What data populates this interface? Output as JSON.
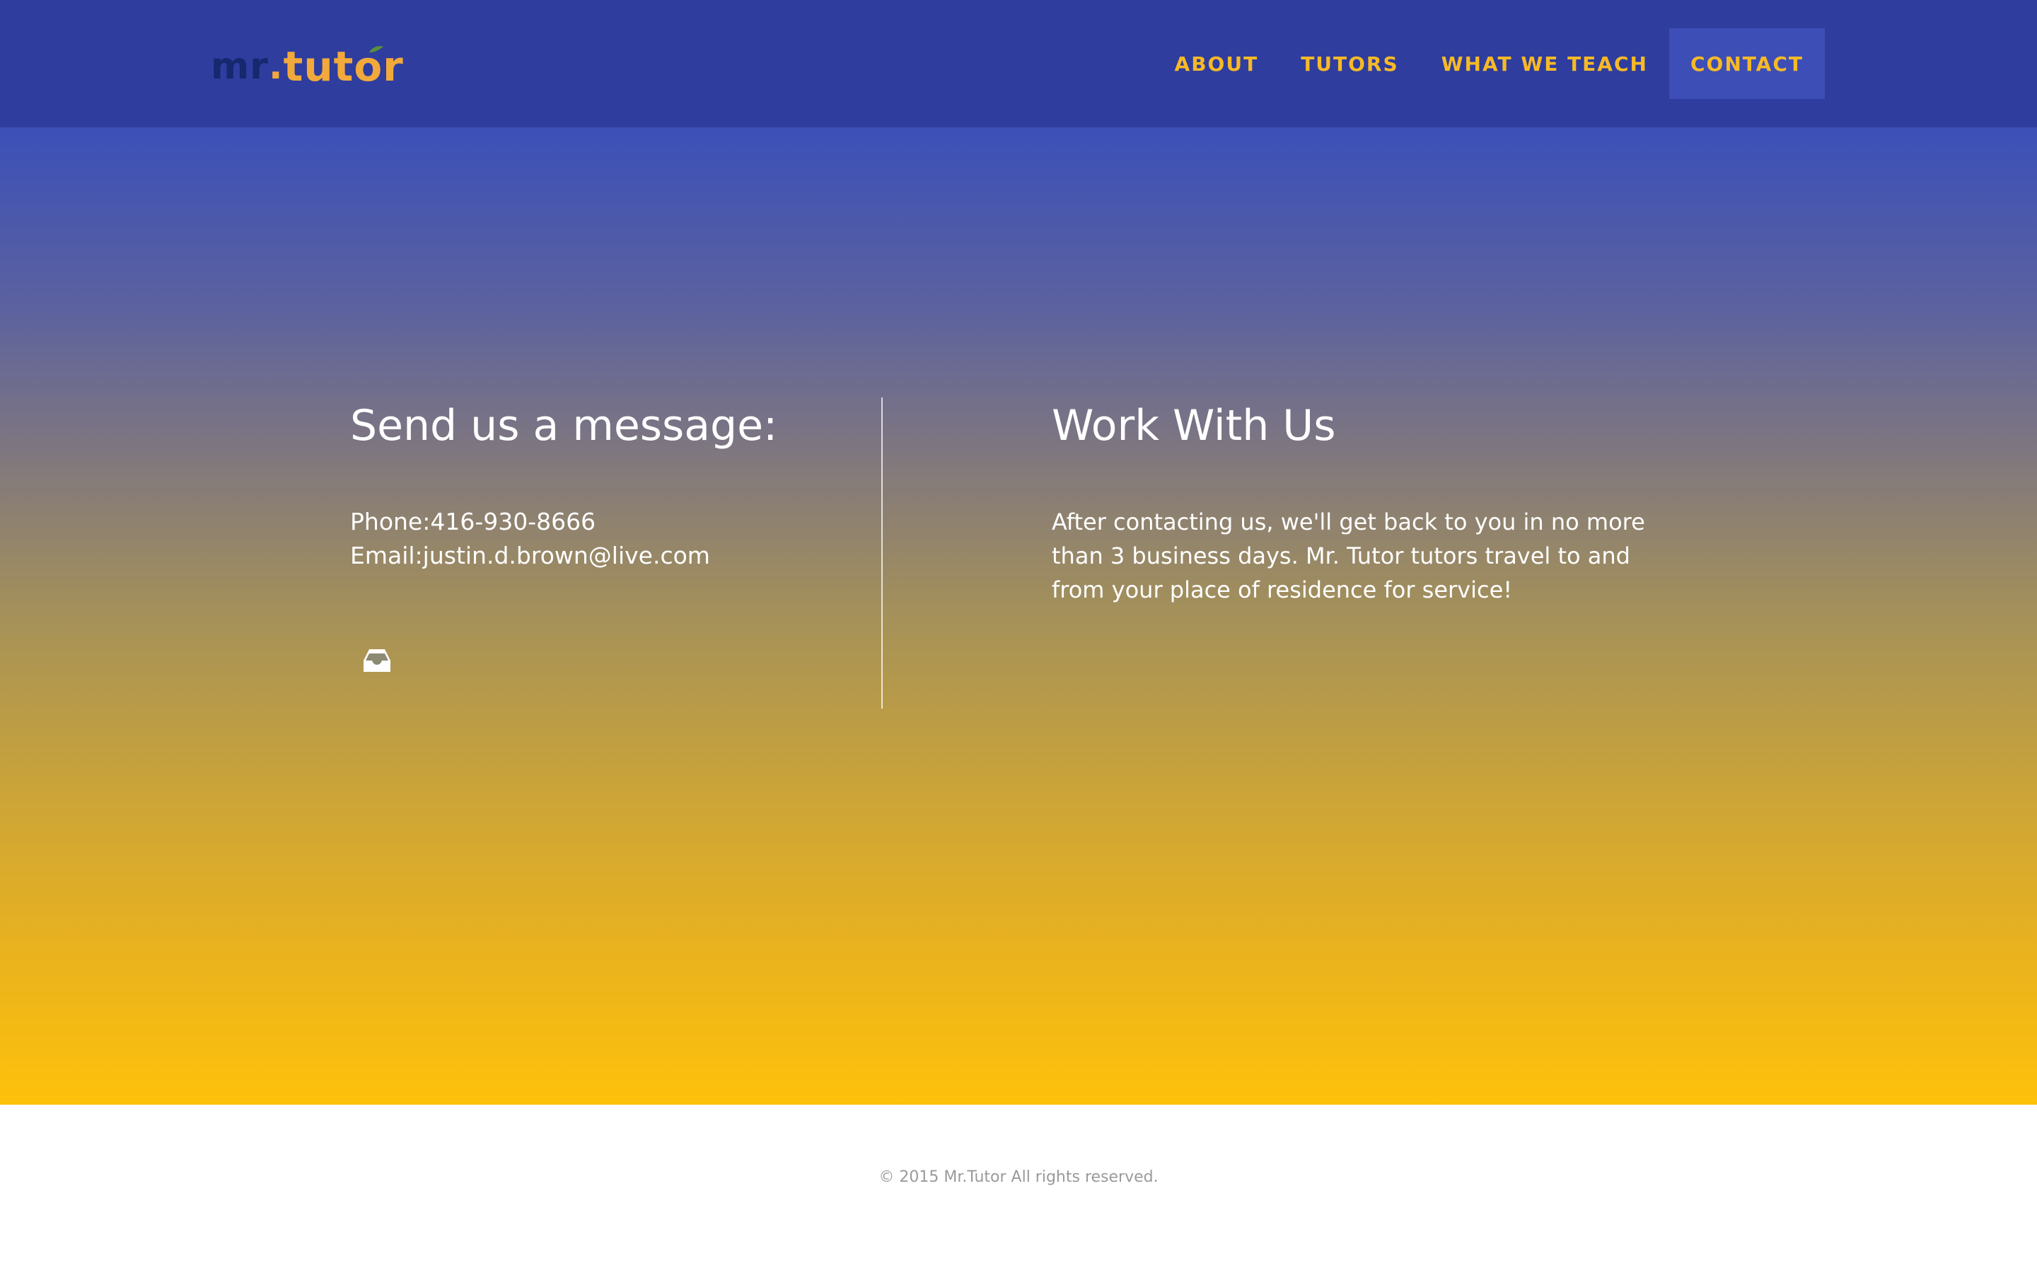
{
  "header": {
    "logo": {
      "part_mr": "mr",
      "part_dot": ".",
      "part_tutor": "tutor"
    },
    "nav": {
      "items": [
        {
          "label": "ABOUT",
          "active": false
        },
        {
          "label": "TUTORS",
          "active": false
        },
        {
          "label": "WHAT WE TEACH",
          "active": false
        },
        {
          "label": "CONTACT",
          "active": true
        }
      ]
    }
  },
  "contact": {
    "left": {
      "heading": "Send us a message:",
      "phone": "Phone:416-930-8666",
      "email": "Email:justin.d.brown@live.com",
      "icon": "inbox-icon"
    },
    "right": {
      "heading": "Work With Us",
      "body": "After contacting us, we'll get back to you in no more than 3 business days. Mr. Tutor tutors travel to and from your place of residence for service!"
    }
  },
  "footer": {
    "copyright": "© 2015 Mr.Tutor All rights reserved."
  },
  "colors": {
    "navbar_bg": "#2e3d9e",
    "nav_text": "#f7b926",
    "nav_active_bg": "#3d4eb6",
    "gradient_top": "#3b50b8",
    "gradient_bottom": "#fec10a",
    "logo_dark": "#16286e",
    "logo_orange": "#f2a93b"
  }
}
